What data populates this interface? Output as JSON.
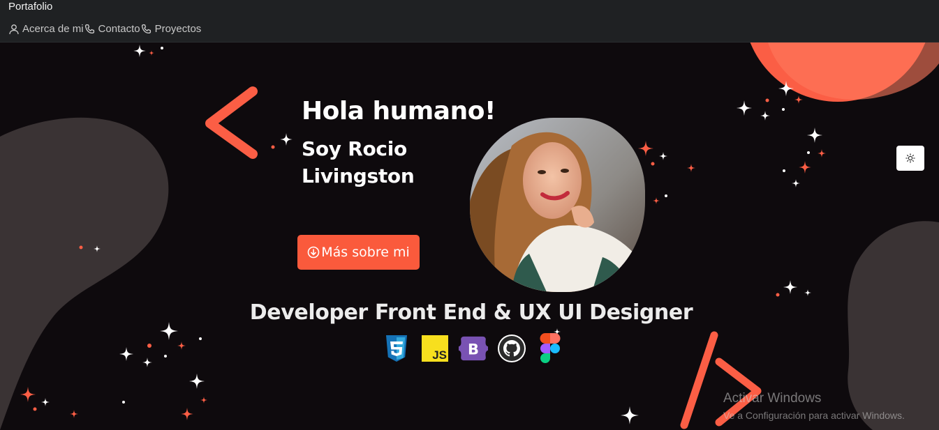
{
  "navbar": {
    "brand": "Portafolio",
    "links": [
      {
        "label": "Acerca de mi",
        "icon": "person-icon"
      },
      {
        "label": "Contacto",
        "icon": "phone-icon"
      },
      {
        "label": "Proyectos",
        "icon": "phone-icon"
      }
    ]
  },
  "hero": {
    "greeting": "Hola humano!",
    "name": "Soy Rocio Livingston",
    "cta_label": "Más sobre mi",
    "role": "Developer Front End & UX UI Designer",
    "tech_icons": [
      "css3-icon",
      "javascript-icon",
      "bootstrap-icon",
      "github-icon",
      "figma-icon"
    ]
  },
  "theme_toggle": {
    "icon": "sun-icon"
  },
  "watermark": {
    "title": "Activar Windows",
    "subtitle": "Ve a Configuración para activar Windows."
  },
  "colors": {
    "accent": "#fa5a3c",
    "background": "#0e0a0d",
    "navbar": "#1f2123",
    "blob": "#3a3334"
  }
}
